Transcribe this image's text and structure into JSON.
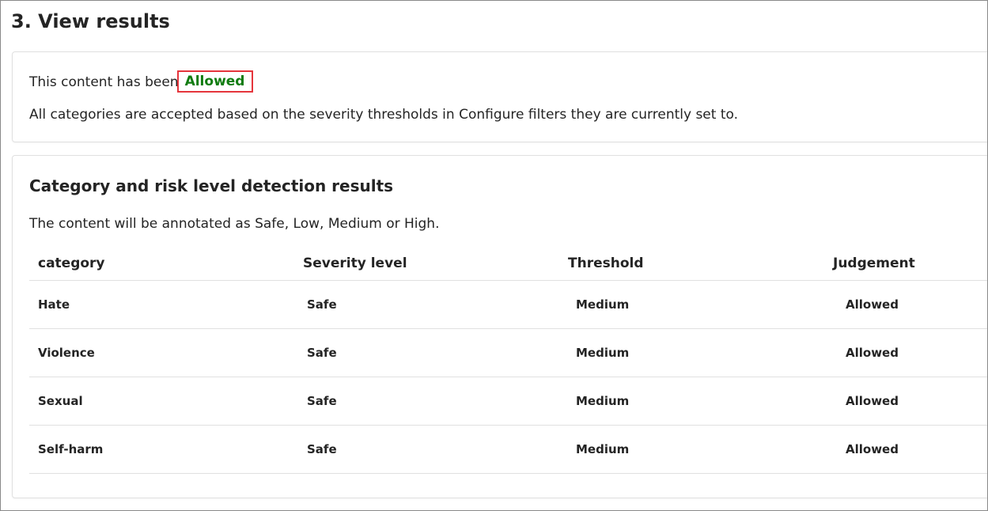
{
  "page_title": "3. View results",
  "status": {
    "prefix": "This content has been",
    "verdict": "Allowed",
    "verdict_color": "#107c10",
    "highlight_color": "#e5353c",
    "description": "All categories are accepted based on the severity thresholds in Configure filters they are currently set to."
  },
  "results": {
    "title": "Category and risk level detection results",
    "description": "The content will be annotated as Safe, Low, Medium or High.",
    "columns": [
      "category",
      "Severity level",
      "Threshold",
      "Judgement"
    ],
    "rows": [
      {
        "category": "Hate",
        "severity": "Safe",
        "threshold": "Medium",
        "judgement": "Allowed"
      },
      {
        "category": "Violence",
        "severity": "Safe",
        "threshold": "Medium",
        "judgement": "Allowed"
      },
      {
        "category": "Sexual",
        "severity": "Safe",
        "threshold": "Medium",
        "judgement": "Allowed"
      },
      {
        "category": "Self-harm",
        "severity": "Safe",
        "threshold": "Medium",
        "judgement": "Allowed"
      }
    ]
  }
}
